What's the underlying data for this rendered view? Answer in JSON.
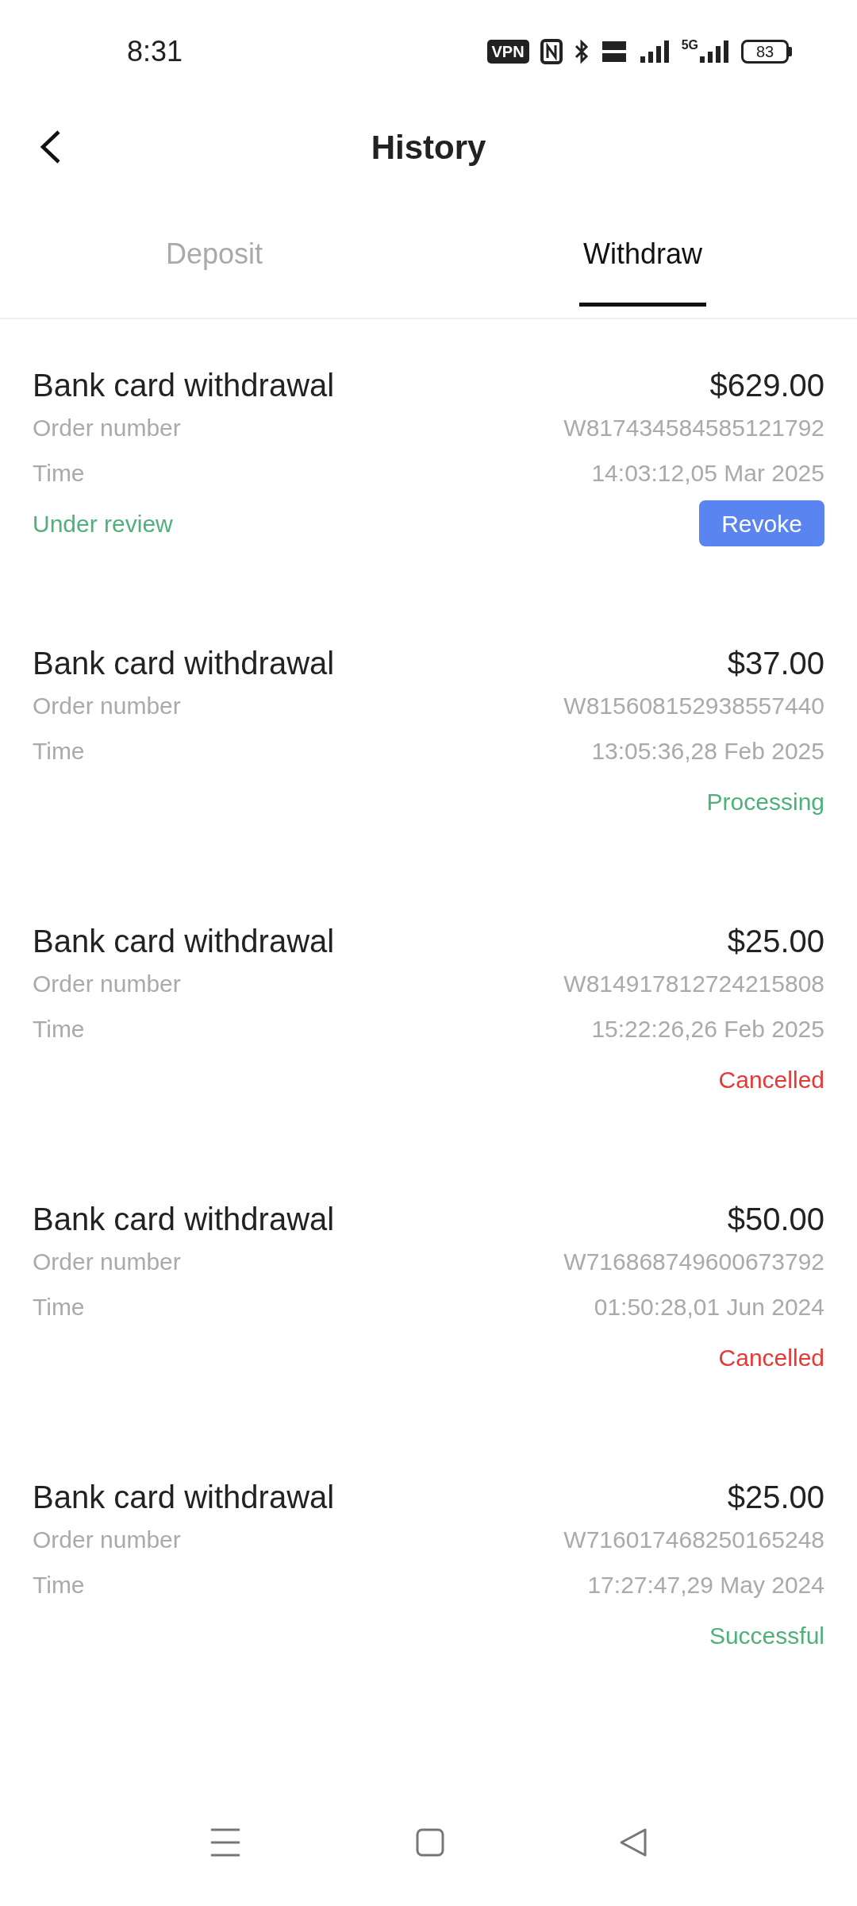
{
  "status_bar": {
    "time": "8:31",
    "vpn": "VPN",
    "network": "5G",
    "battery": "83"
  },
  "header": {
    "title": "History"
  },
  "tabs": [
    {
      "label": "Deposit",
      "selected": false
    },
    {
      "label": "Withdraw",
      "selected": true
    }
  ],
  "records": [
    {
      "title": "Bank card withdrawal",
      "amount": "$629.00",
      "order_label": "Order number",
      "order_number": "W817434584585121792",
      "time_label": "Time",
      "time": "14:03:12,05 Mar 2025",
      "status": {
        "text": "Under review",
        "kind": "pending"
      },
      "action": "Revoke"
    },
    {
      "title": "Bank card withdrawal",
      "amount": "$37.00",
      "order_label": "Order number",
      "order_number": "W815608152938557440",
      "time_label": "Time",
      "time": "13:05:36,28 Feb 2025",
      "status": {
        "text": "Processing",
        "kind": "ok"
      }
    },
    {
      "title": "Bank card withdrawal",
      "amount": "$25.00",
      "order_label": "Order number",
      "order_number": "W814917812724215808",
      "time_label": "Time",
      "time": "15:22:26,26 Feb 2025",
      "status": {
        "text": "Cancelled",
        "kind": "failed"
      }
    },
    {
      "title": "Bank card withdrawal",
      "amount": "$50.00",
      "order_label": "Order number",
      "order_number": "W716868749600673792",
      "time_label": "Time",
      "time": "01:50:28,01 Jun 2024",
      "status": {
        "text": "Cancelled",
        "kind": "failed"
      }
    },
    {
      "title": "Bank card withdrawal",
      "amount": "$25.00",
      "order_label": "Order number",
      "order_number": "W716017468250165248",
      "time_label": "Time",
      "time": "17:27:47,29 May 2024",
      "status": {
        "text": "Successful",
        "kind": "ok"
      }
    }
  ]
}
